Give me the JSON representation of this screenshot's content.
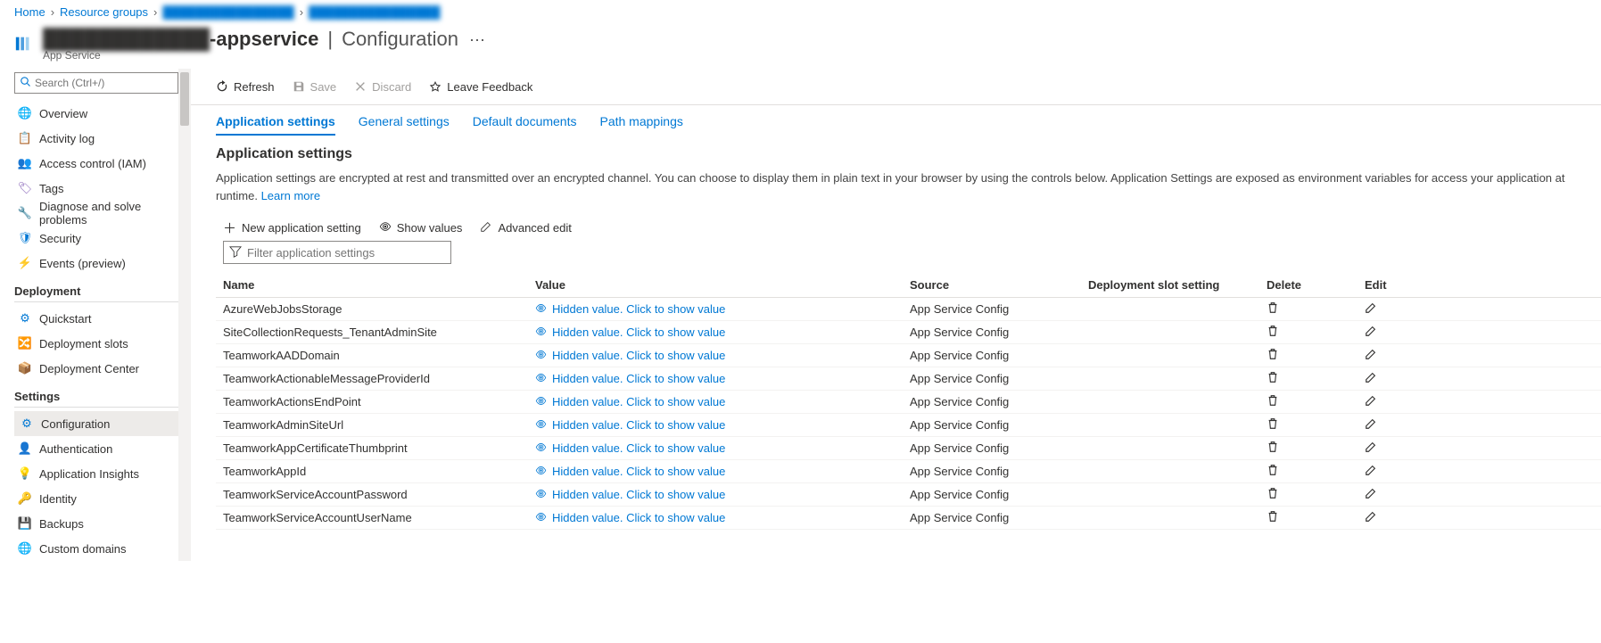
{
  "breadcrumb": {
    "home": "Home",
    "rg": "Resource groups",
    "blurred1": "████████████████",
    "blurred2": "████████████████"
  },
  "header": {
    "title_prefix_blur": "████████████",
    "title_suffix": "-appservice",
    "title_section": "Configuration",
    "subtype": "App Service"
  },
  "sidebar": {
    "search_placeholder": "Search (Ctrl+/)",
    "items": {
      "overview": "Overview",
      "activity": "Activity log",
      "iam": "Access control (IAM)",
      "tags": "Tags",
      "diagnose": "Diagnose and solve problems",
      "security": "Security",
      "events": "Events (preview)"
    },
    "groups": {
      "deployment": "Deployment",
      "settings": "Settings"
    },
    "deployment": {
      "quickstart": "Quickstart",
      "slots": "Deployment slots",
      "center": "Deployment Center"
    },
    "settings": {
      "configuration": "Configuration",
      "authentication": "Authentication",
      "appinsights": "Application Insights",
      "identity": "Identity",
      "backups": "Backups",
      "customdomains": "Custom domains"
    }
  },
  "toolbar": {
    "refresh": "Refresh",
    "save": "Save",
    "discard": "Discard",
    "feedback": "Leave Feedback"
  },
  "tabs": {
    "app": "Application settings",
    "general": "General settings",
    "default": "Default documents",
    "path": "Path mappings"
  },
  "section": {
    "title": "Application settings",
    "desc_part1": "Application settings are encrypted at rest and transmitted over an encrypted channel. You can choose to display them in plain text in your browser by using the controls below. Application Settings are exposed as environment variables for access your application at runtime. ",
    "learn_more": "Learn more"
  },
  "actions": {
    "new": "New application setting",
    "show": "Show values",
    "advanced": "Advanced edit",
    "filter_placeholder": "Filter application settings"
  },
  "table": {
    "headers": {
      "name": "Name",
      "value": "Value",
      "source": "Source",
      "slot": "Deployment slot setting",
      "delete": "Delete",
      "edit": "Edit"
    },
    "hidden_text": "Hidden value. Click to show value",
    "source_text": "App Service Config",
    "rows": [
      {
        "name": "AzureWebJobsStorage"
      },
      {
        "name": "SiteCollectionRequests_TenantAdminSite"
      },
      {
        "name": "TeamworkAADDomain"
      },
      {
        "name": "TeamworkActionableMessageProviderId"
      },
      {
        "name": "TeamworkActionsEndPoint"
      },
      {
        "name": "TeamworkAdminSiteUrl"
      },
      {
        "name": "TeamworkAppCertificateThumbprint"
      },
      {
        "name": "TeamworkAppId"
      },
      {
        "name": "TeamworkServiceAccountPassword"
      },
      {
        "name": "TeamworkServiceAccountUserName"
      }
    ]
  }
}
